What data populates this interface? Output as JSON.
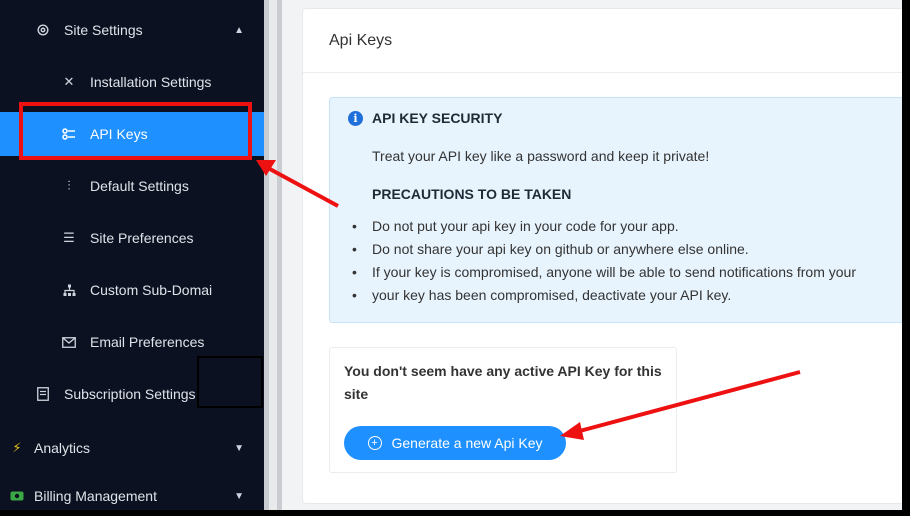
{
  "sidebar": {
    "site_settings": "Site Settings",
    "installation_settings": "Installation Settings",
    "api_keys": "API Keys",
    "default_settings": "Default Settings",
    "site_preferences": "Site Preferences",
    "custom_sub_domain": "Custom Sub-Domai",
    "email_preferences": "Email Preferences",
    "subscription_settings": "Subscription Settings",
    "analytics": "Analytics",
    "billing_management": "Billing Management"
  },
  "main": {
    "card_title": "Api Keys",
    "alert": {
      "title": "API KEY SECURITY",
      "subtitle": "Treat your API key like a password and keep it private!",
      "precautions_title": "PRECAUTIONS TO BE TAKEN",
      "items": [
        "Do not put your api key in your code for your app.",
        "Do not share your api key on github or anywhere else online.",
        "If your key is compromised, anyone will be able to send notifications from your",
        "your key has been compromised, deactivate your API key."
      ]
    },
    "empty_message": "You don't seem have any active API Key for this site",
    "generate_button": "Generate a new Api Key"
  },
  "colors": {
    "sidebar_bg": "#0b1120",
    "accent": "#1e90ff",
    "annotation_red": "#e11111",
    "alert_bg": "#e8f4fd"
  }
}
